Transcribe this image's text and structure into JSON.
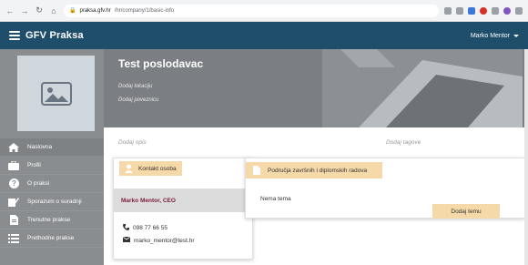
{
  "browser": {
    "url_host": "praksa.gfv.hr",
    "url_path": "/hr/company/1/basic-info"
  },
  "navbar": {
    "brand": "GFV Praksa",
    "user": "Marko Mentor"
  },
  "sidebar": {
    "items": [
      {
        "label": "Naslovna",
        "icon": "home-icon"
      },
      {
        "label": "Profil",
        "icon": "briefcase-icon"
      },
      {
        "label": "O praksi",
        "icon": "question-icon"
      },
      {
        "label": "Sporazum o suradnji",
        "icon": "pen-document-icon"
      },
      {
        "label": "Trenutne prakse",
        "icon": "document-icon"
      },
      {
        "label": "Prethodne prakse",
        "icon": "list-icon"
      }
    ]
  },
  "header": {
    "company_name": "Test poslodavac",
    "add_location": "Dodaj lokaciju",
    "add_website": "Dodaj poveznicu"
  },
  "main": {
    "add_description": "Dodaj opis",
    "add_tags": "Dodaj tagove"
  },
  "contact": {
    "title": "Kontakt osoba",
    "name": "Marko Mentor, CEO",
    "phone": "098 77 66 55",
    "email": "marko_mentor@test.hr"
  },
  "areas": {
    "title": "Područja završnih i diplomskih radova",
    "empty": "Nema tema",
    "add_button": "Dodaj temu"
  },
  "colors": {
    "navbar": "#1f4e6b",
    "sidebar": "#8a8d90",
    "accent_chip": "#f5d9a8",
    "contact_name": "#7a1c3e"
  }
}
